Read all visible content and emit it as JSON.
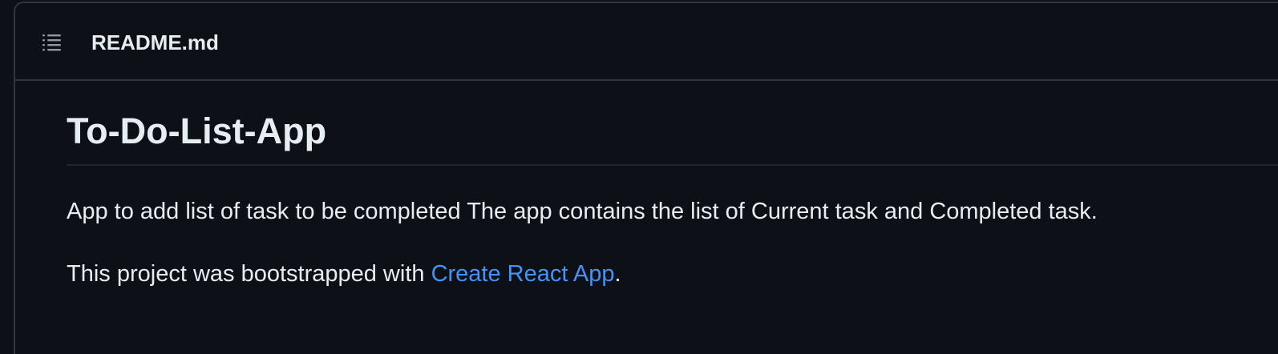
{
  "readme": {
    "file_name": "README.md",
    "toc_icon": "list-unordered-icon",
    "title": "To-Do-List-App",
    "paragraph_1": "App to add list of task to be completed The app contains the list of Current task and Completed task.",
    "paragraph_2_prefix": "This project was bootstrapped with ",
    "paragraph_2_link": "Create React App",
    "paragraph_2_suffix": "."
  },
  "colors": {
    "background": "#0d1117",
    "border": "#30363d",
    "text": "#e6edf3",
    "link": "#4493f8",
    "icon": "#9198a1"
  }
}
